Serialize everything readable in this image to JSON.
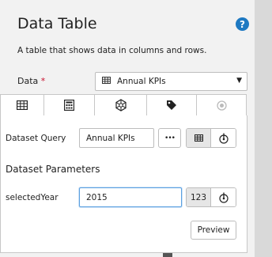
{
  "header": {
    "title": "Data Table",
    "help_label": "?",
    "description": "A table that shows data in columns and rows."
  },
  "data_field": {
    "label": "Data",
    "required_mark": "*",
    "selected": "Annual KPIs",
    "caret": "▼"
  },
  "tabs": [
    {
      "name": "table",
      "icon": "table-icon"
    },
    {
      "name": "calculator",
      "icon": "calculator-icon"
    },
    {
      "name": "connection",
      "icon": "network-icon"
    },
    {
      "name": "tag",
      "icon": "tag-icon"
    },
    {
      "name": "record",
      "icon": "radio-icon"
    }
  ],
  "dataset_query": {
    "label": "Dataset Query",
    "value": "Annual KPIs",
    "more_label": "•••"
  },
  "parameters": {
    "section_title": "Dataset Parameters",
    "items": [
      {
        "label": "selectedYear",
        "value": "2015",
        "type_badge": "123"
      }
    ]
  },
  "preview_label": "Preview",
  "colors": {
    "accent": "#1e79c2",
    "required": "#c8102e",
    "focus": "#5aa0e0"
  }
}
